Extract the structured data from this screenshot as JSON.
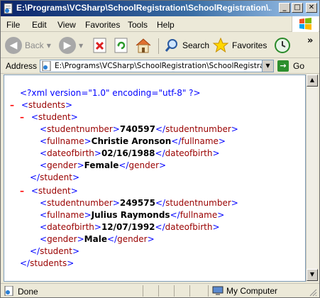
{
  "window": {
    "title": "E:\\Programs\\VCSharp\\SchoolRegistration\\SchoolRegistration\\..."
  },
  "titlebar_buttons": {
    "minimize": "_",
    "maximize": "□",
    "close": "✕"
  },
  "menu": [
    "File",
    "Edit",
    "View",
    "Favorites",
    "Tools",
    "Help"
  ],
  "toolbar": {
    "back": "Back",
    "search": "Search",
    "favorites": "Favorites",
    "overflow": "»"
  },
  "address": {
    "label": "Address",
    "value": "E:\\Programs\\VCSharp\\SchoolRegistration\\SchoolRegistration\\",
    "go": "Go"
  },
  "xml": {
    "declaration": "<?xml version=\"1.0\" encoding=\"utf-8\" ?>",
    "minus": "–",
    "root_tag": "students",
    "student_tag": "student",
    "students": [
      {
        "studentnumber": "740597",
        "fullname": "Christie Aronson",
        "dateofbirth": "02/16/1988",
        "gender": "Female"
      },
      {
        "studentnumber": "249575",
        "fullname": "Julius Raymonds",
        "dateofbirth": "12/07/1992",
        "gender": "Male"
      }
    ],
    "field_tags": {
      "studentnumber": "studentnumber",
      "fullname": "fullname",
      "dateofbirth": "dateofbirth",
      "gender": "gender"
    }
  },
  "status": {
    "text": "Done",
    "zone": "My Computer"
  }
}
